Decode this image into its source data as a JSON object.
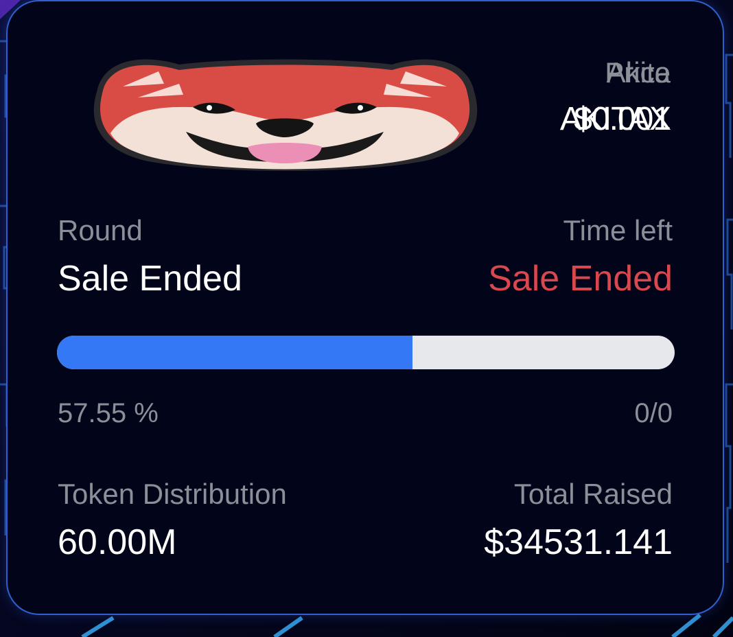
{
  "header": {
    "token_name_label": "Akita",
    "price_label": "Price",
    "token_symbol": "AKITAX",
    "price_value": "$0.001"
  },
  "round": {
    "label": "Round",
    "value": "Sale Ended"
  },
  "time_left": {
    "label": "Time left",
    "value": "Sale Ended",
    "color": "#d9484e"
  },
  "progress": {
    "percent": 57.55,
    "percent_text": "57.55 %",
    "count_text": "0/0",
    "fill_color": "#3478f6",
    "track_color": "#e7e8ec"
  },
  "token_distribution": {
    "label": "Token Distribution",
    "value": "60.00M"
  },
  "total_raised": {
    "label": "Total Raised",
    "value": "$34531.141"
  },
  "icons": {
    "logo": "akita-dog-logo-icon"
  }
}
